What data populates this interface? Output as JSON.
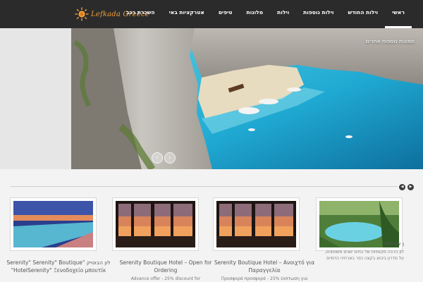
{
  "logo": {
    "text": "Lefkada Greece"
  },
  "nav": [
    "ראשי",
    "וילות החודש",
    "וילות נוספות",
    "וילות",
    "מלונות",
    "טיפים",
    "אטרקציות באי",
    "השכרת רכב"
  ],
  "hero": {
    "caption": "תמונות נוספות  אתרים"
  },
  "cards": [
    {
      "title": "ן אוריסס",
      "sub": "לון הרבה מקומיות של בתים ישנים משופצים, על מדרון ביבוא בקצה כפר בארחיני הדמיים"
    },
    {
      "title": "Serenity Boutique Hotel – Ανοιχτό για Παραγγελία",
      "sub": "Προσφορά προσφορά - 25% έκπτωση για"
    },
    {
      "title": "Serenity Boutique Hotel – Open for Ordering",
      "sub": "Advance offer - 25% discount for"
    },
    {
      "title": "לון הבוטיק \"Serenity\" Serenity\" Boutique HotelSerenity\" Ξενοδοχείο μπουτίκ\"",
      "sub": ""
    }
  ],
  "colors": {
    "topbar": "#2b2b2b",
    "logo": "#f2a23a",
    "sea": "#2fb4d6"
  }
}
